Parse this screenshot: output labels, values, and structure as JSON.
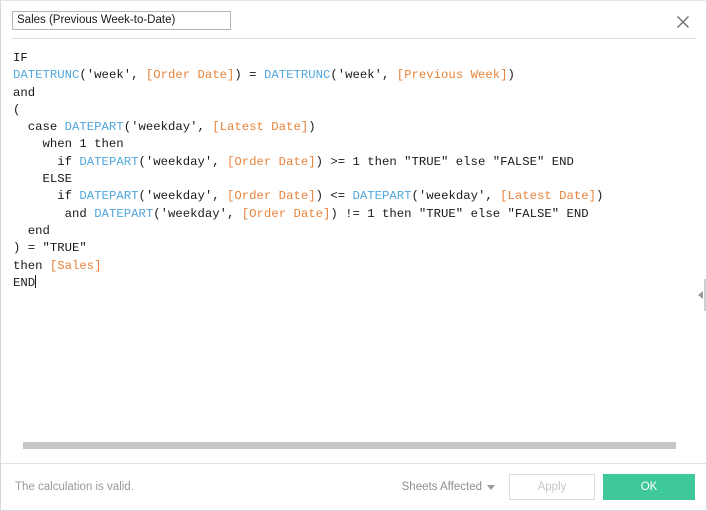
{
  "dialog": {
    "name_field": {
      "value": "Sales (Previous Week-to-Date)",
      "placeholder": "Field Name"
    },
    "close_label": "×"
  },
  "formula": {
    "lines": [
      [
        {
          "t": "IF",
          "c": "txt"
        }
      ],
      [
        {
          "t": "DATETRUNC",
          "c": "fn"
        },
        {
          "t": "('week', ",
          "c": "txt"
        },
        {
          "t": "[Order Date]",
          "c": "fld"
        },
        {
          "t": ") = ",
          "c": "txt"
        },
        {
          "t": "DATETRUNC",
          "c": "fn"
        },
        {
          "t": "('week', ",
          "c": "txt"
        },
        {
          "t": "[Previous Week]",
          "c": "fld"
        },
        {
          "t": ")",
          "c": "txt"
        }
      ],
      [
        {
          "t": "and",
          "c": "txt"
        }
      ],
      [
        {
          "t": "(",
          "c": "txt"
        }
      ],
      [
        {
          "t": "  case ",
          "c": "txt"
        },
        {
          "t": "DATEPART",
          "c": "fn"
        },
        {
          "t": "('weekday', ",
          "c": "txt"
        },
        {
          "t": "[Latest Date]",
          "c": "fld"
        },
        {
          "t": ")",
          "c": "txt"
        }
      ],
      [
        {
          "t": "    when 1 then",
          "c": "txt"
        }
      ],
      [
        {
          "t": "      if ",
          "c": "txt"
        },
        {
          "t": "DATEPART",
          "c": "fn"
        },
        {
          "t": "('weekday', ",
          "c": "txt"
        },
        {
          "t": "[Order Date]",
          "c": "fld"
        },
        {
          "t": ") >= 1 then \"TRUE\" else \"FALSE\" END",
          "c": "txt"
        }
      ],
      [
        {
          "t": "    ELSE",
          "c": "txt"
        }
      ],
      [
        {
          "t": "      if ",
          "c": "txt"
        },
        {
          "t": "DATEPART",
          "c": "fn"
        },
        {
          "t": "('weekday', ",
          "c": "txt"
        },
        {
          "t": "[Order Date]",
          "c": "fld"
        },
        {
          "t": ") <= ",
          "c": "txt"
        },
        {
          "t": "DATEPART",
          "c": "fn"
        },
        {
          "t": "('weekday', ",
          "c": "txt"
        },
        {
          "t": "[Latest Date]",
          "c": "fld"
        },
        {
          "t": ")",
          "c": "txt"
        }
      ],
      [
        {
          "t": "       and ",
          "c": "txt"
        },
        {
          "t": "DATEPART",
          "c": "fn"
        },
        {
          "t": "('weekday', ",
          "c": "txt"
        },
        {
          "t": "[Order Date]",
          "c": "fld"
        },
        {
          "t": ") != 1 then \"TRUE\" else \"FALSE\" END",
          "c": "txt"
        }
      ],
      [
        {
          "t": "  end",
          "c": "txt"
        }
      ],
      [
        {
          "t": ") = \"TRUE\"",
          "c": "txt"
        }
      ],
      [
        {
          "t": "then ",
          "c": "txt"
        },
        {
          "t": "[Sales]",
          "c": "fld"
        }
      ],
      [
        {
          "t": "END",
          "c": "txt"
        },
        {
          "t": "",
          "c": "caret"
        }
      ]
    ]
  },
  "footer": {
    "status": "The calculation is valid.",
    "sheets_affected_label": "Sheets Affected",
    "apply_label": "Apply",
    "ok_label": "OK"
  },
  "colors": {
    "function": "#51a7dd",
    "field": "#e8833a",
    "text": "#1a1a1a",
    "ok_button": "#3fc99a",
    "status_text": "#9a9a9a"
  }
}
